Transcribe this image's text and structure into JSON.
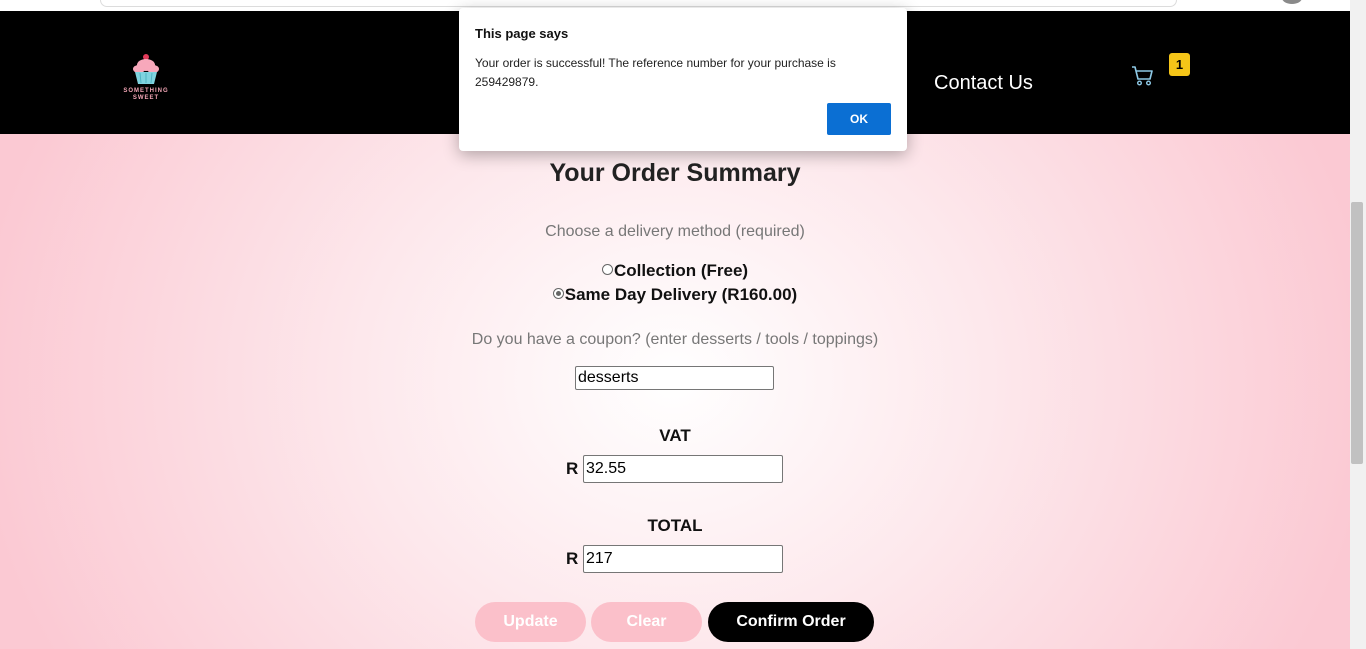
{
  "brand": {
    "logo_text": "SOMETHING SWEET"
  },
  "nav": {
    "contact": "Contact Us",
    "cart_count": "1"
  },
  "order": {
    "title": "Your Order Summary",
    "delivery_prompt": "Choose a delivery method (required)",
    "delivery_options": [
      {
        "label": "Collection (Free)",
        "checked": false
      },
      {
        "label": "Same Day Delivery (R160.00)",
        "checked": true
      }
    ],
    "coupon_prompt": "Do you have a coupon? (enter desserts / tools / toppings)",
    "coupon_value": "desserts",
    "vat_label": "VAT",
    "vat_currency": "R",
    "vat_value": "32.55",
    "total_label": "TOTAL",
    "total_currency": "R",
    "total_value": "217"
  },
  "buttons": {
    "update": "Update",
    "clear": "Clear",
    "confirm": "Confirm Order"
  },
  "dialog": {
    "title": "This page says",
    "message": "Your order is successful! The reference number for your purchase is 259429879.",
    "ok": "OK"
  },
  "colors": {
    "accent_pink": "#fbc0ca",
    "dialog_button": "#0b6fd3",
    "badge": "#f5c518"
  }
}
